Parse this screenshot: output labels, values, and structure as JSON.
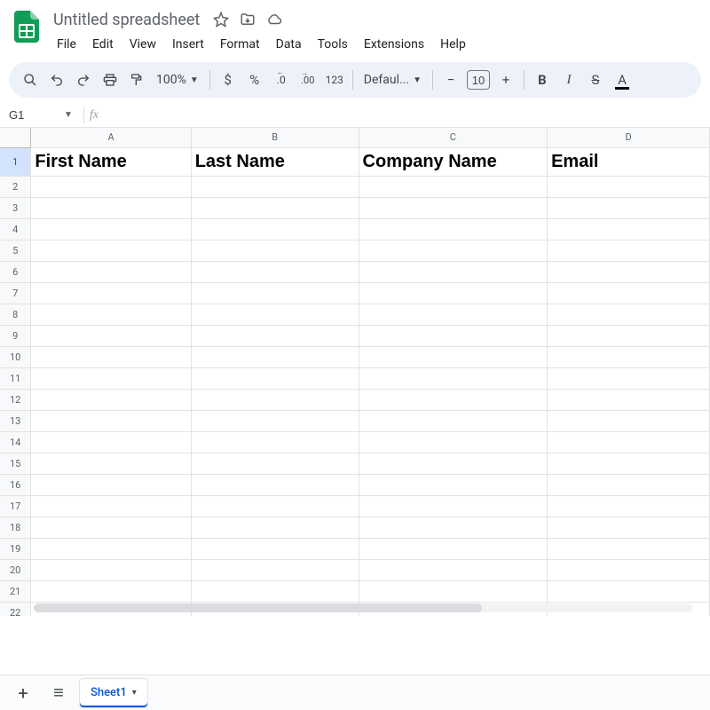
{
  "doc": {
    "title": "Untitled spreadsheet"
  },
  "menus": {
    "file": "File",
    "edit": "Edit",
    "view": "View",
    "insert": "Insert",
    "format": "Format",
    "data": "Data",
    "tools": "Tools",
    "extensions": "Extensions",
    "help": "Help"
  },
  "toolbar": {
    "zoom": "100%",
    "currency": "$",
    "percent": "%",
    "dec_dec": ".0",
    "dec_inc": ".00",
    "num_fmt": "123",
    "font": "Defaul...",
    "font_size": "10",
    "bold": "B",
    "italic": "I",
    "strike": "S",
    "textcolor": "A"
  },
  "namebox": {
    "ref": "G1"
  },
  "columns": [
    "A",
    "B",
    "C",
    "D"
  ],
  "row_count": 22,
  "header_cells": {
    "A": "First Name",
    "B": "Last Name",
    "C": "Company Name",
    "D": "Email"
  },
  "tabs": {
    "sheet1": "Sheet1"
  },
  "glyphs": {
    "minus": "−",
    "plus": "+",
    "all_sheets": "≡",
    "add": "+",
    "caret": "▾",
    "caret_small": "▼"
  }
}
